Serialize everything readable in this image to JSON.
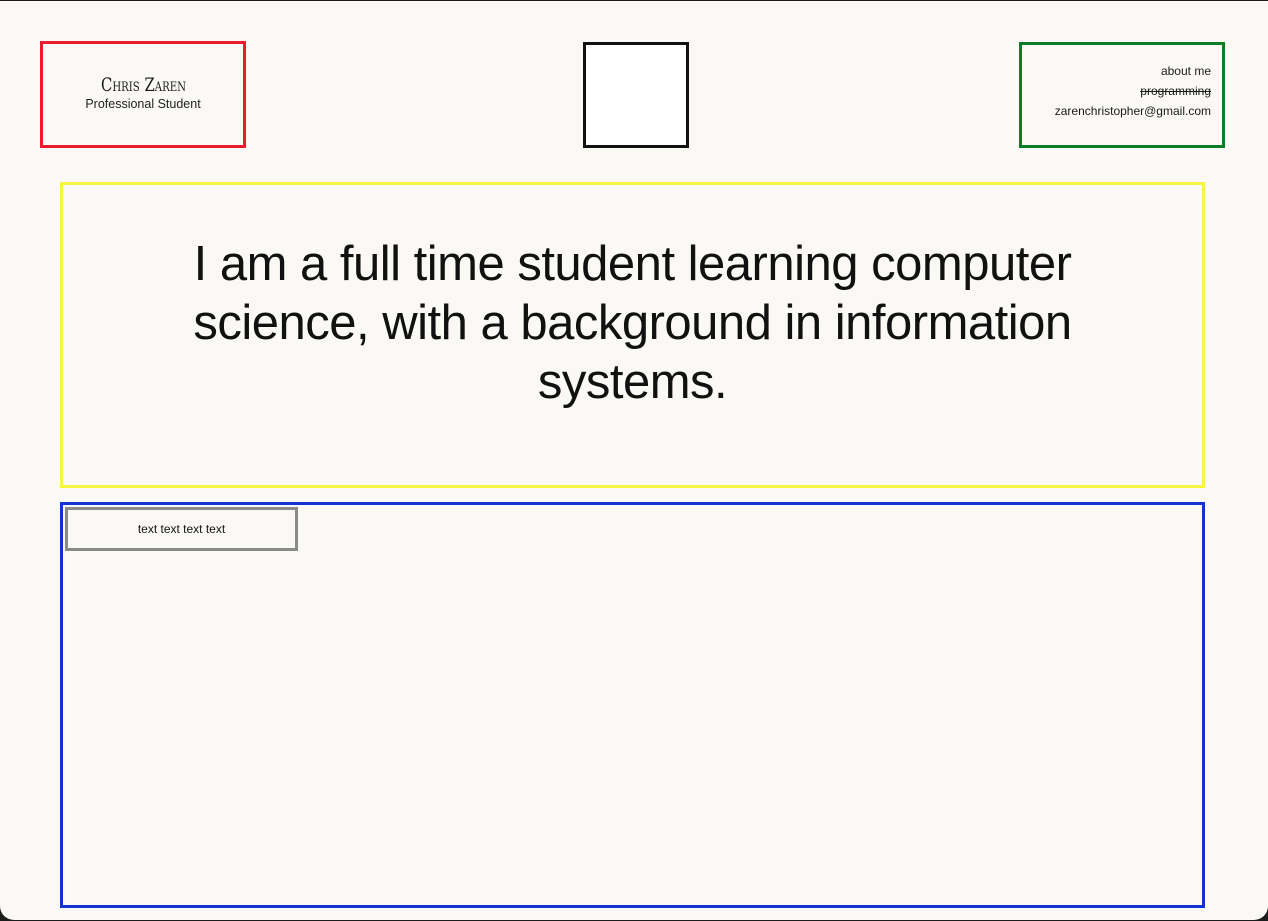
{
  "header": {
    "name": "Chris Zaren",
    "subtitle": "Professional Student"
  },
  "nav": {
    "items": [
      {
        "label": "about me"
      },
      {
        "label": "programming"
      },
      {
        "label": "zarenchristopher@gmail.com"
      }
    ]
  },
  "intro": {
    "text": "I am a full time student learning computer science, with a background in information systems."
  },
  "content": {
    "card_text": "text text text text"
  },
  "colors": {
    "name_border": "#ee1a2f",
    "nav_border": "#0a7d26",
    "intro_border": "#f7f544",
    "content_border": "#1433d6",
    "card_border": "#8a8a8a",
    "background": "#faf9f5"
  }
}
